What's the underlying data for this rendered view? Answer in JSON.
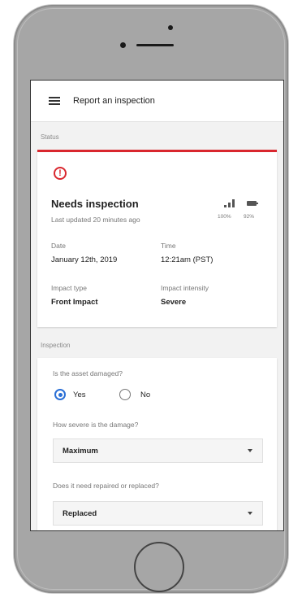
{
  "appbar": {
    "title": "Report an inspection"
  },
  "status_section": {
    "label": "Status"
  },
  "status_card": {
    "title": "Needs inspection",
    "subtitle": "Last updated 20 minutes ago",
    "signal": "100%",
    "battery": "92%",
    "date_label": "Date",
    "date_value": "January 12th, 2019",
    "time_label": "Time",
    "time_value": "12:21am (PST)",
    "impact_type_label": "Impact type",
    "impact_type_value": "Front Impact",
    "impact_intensity_label": "Impact intensity",
    "impact_intensity_value": "Severe"
  },
  "inspection_section": {
    "label": "Inspection"
  },
  "inspection_form": {
    "q1": "Is the asset damaged?",
    "yes": "Yes",
    "no": "No",
    "q2": "How severe is the damage?",
    "severity_value": "Maximum",
    "q3": "Does it need repaired or replaced?",
    "repair_value": "Replaced"
  },
  "accent_colors": {
    "alert": "#d9272e",
    "radio": "#2a6fd6"
  },
  "icons": [
    "menu-icon",
    "alert-icon",
    "signal-icon",
    "battery-icon",
    "chevron-down-icon"
  ]
}
